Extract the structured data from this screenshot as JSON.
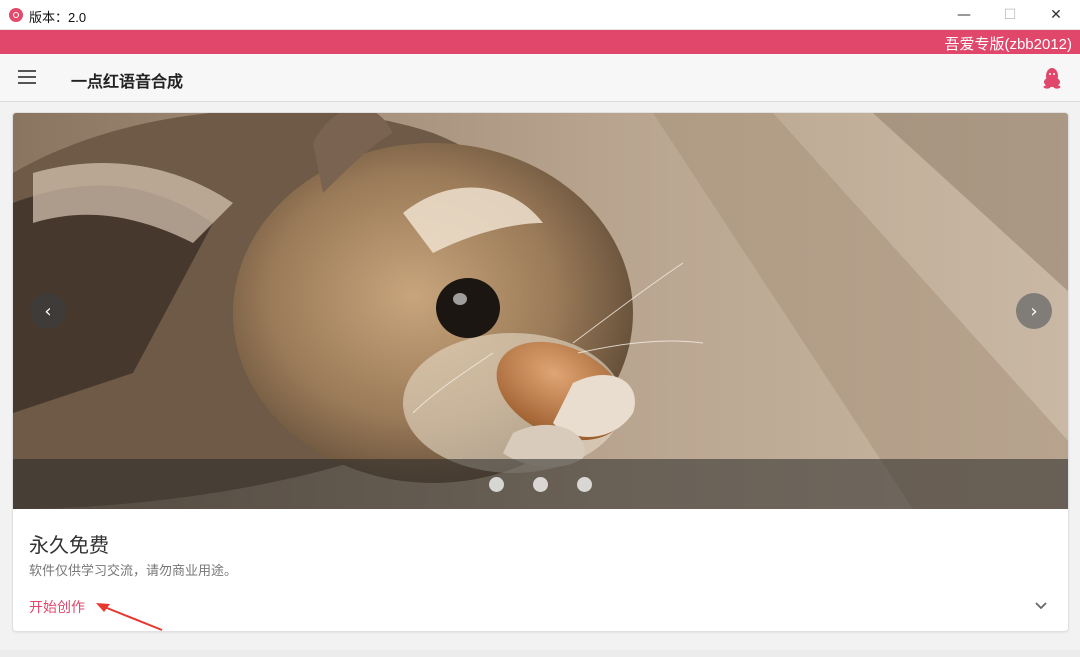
{
  "window": {
    "title": "版本：2.0",
    "app_icon": "app-logo-icon",
    "controls": {
      "minimize": "—",
      "maximize": "☐",
      "close": "✕"
    }
  },
  "banner": {
    "text": "吾爱专版(zbb2012)",
    "color": "#e0476b"
  },
  "appbar": {
    "title": "一点红语音合成",
    "menu_icon": "hamburger-menu-icon",
    "qq_icon": "qq-penguin-icon"
  },
  "card": {
    "carousel": {
      "image": "chipmunk-eating-almond-photo",
      "prev_icon": "‹",
      "next_icon": "›",
      "slide_count": 3
    },
    "title": "永久免费",
    "subtitle": "软件仅供学习交流，请勿商业用途。",
    "action_label": "开始创作",
    "expand_icon": "chevron-down-icon"
  },
  "colors": {
    "accent": "#e0476b",
    "annotation_arrow": "#e8372f"
  }
}
